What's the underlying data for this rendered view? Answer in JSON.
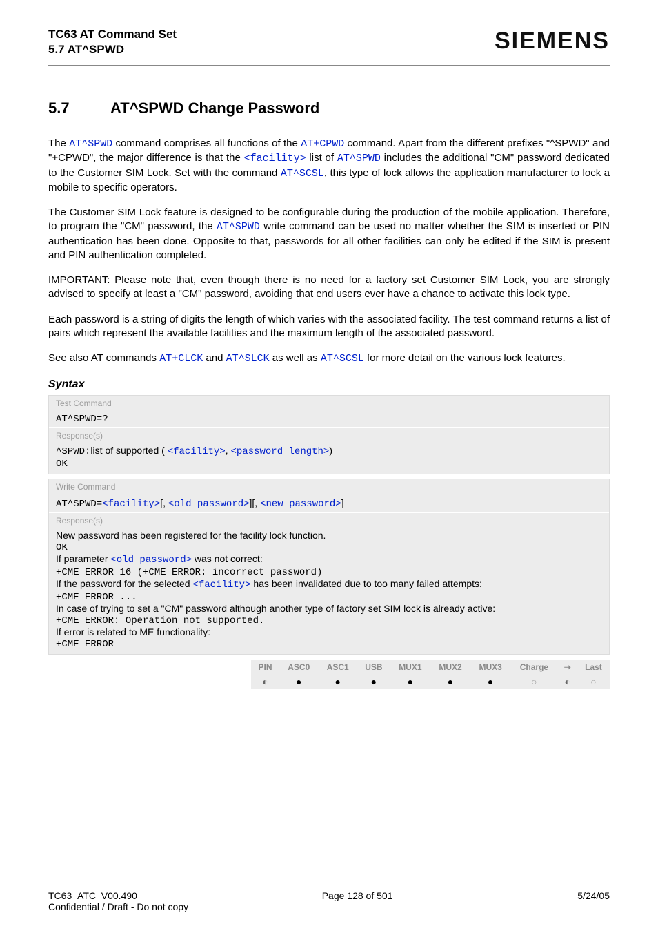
{
  "header": {
    "title": "TC63 AT Command Set",
    "subtitle": "5.7 AT^SPWD",
    "brand": "SIEMENS"
  },
  "section": {
    "number": "5.7",
    "title": "AT^SPWD   Change Password"
  },
  "para1": {
    "t1": "The ",
    "l1": "AT^SPWD",
    "t2": " command comprises all functions of the ",
    "l2": "AT+CPWD",
    "t3": " command. Apart from the different prefixes \"^SPWD\" and \"+CPWD\", the major difference is that the ",
    "l3": "<facility>",
    "t4": " list of ",
    "l4": "AT^SPWD",
    "t5": " includes the additional \"CM\" password dedicated to the Customer SIM Lock. Set with the command ",
    "l5": "AT^SCSL",
    "t6": ", this type of lock allows the application manufacturer to lock a mobile to specific operators."
  },
  "para2": {
    "t1": "The Customer SIM Lock feature is designed to be configurable during the production of the mobile application. Therefore, to program the \"CM\" password, the ",
    "l1": "AT^SPWD",
    "t2": " write command can be used no matter whether the SIM is inserted or PIN authentication has been done. Opposite to that, passwords for all other facilities can only be edited if the SIM is present and PIN authentication completed."
  },
  "para3": "IMPORTANT: Please note that, even though there is no need for a factory set Customer SIM Lock, you are strongly advised to specify at least a \"CM\" password, avoiding that end users ever have a chance to activate this lock type.",
  "para4": "Each password is a string of digits the length of which varies with the associated facility. The test command returns a list of pairs which represent the available facilities and the maximum length of the associated password.",
  "para5": {
    "t1": "See also AT commands ",
    "l1": "AT+CLCK",
    "t2": " and ",
    "l2": "AT^SLCK",
    "t3": " as well as ",
    "l3": "AT^SCSL",
    "t4": " for more detail on the various lock features."
  },
  "syntax": {
    "label": "Syntax",
    "test": {
      "label": "Test Command",
      "cmd": "AT^SPWD=?",
      "resp_label": "Response(s)",
      "resp_prefix": "^SPWD:",
      "resp_text1": "list of supported ( ",
      "resp_link1": "<facility>",
      "resp_text2": ", ",
      "resp_link2": "<password length>",
      "resp_text3": ")",
      "ok": "OK"
    },
    "write": {
      "label": "Write Command",
      "cmd_prefix": "AT^SPWD=",
      "cmd_l1": "<facility>",
      "cmd_t1": "[, ",
      "cmd_l2": "<old password>",
      "cmd_t2": "][, ",
      "cmd_l3": "<new password>",
      "cmd_t3": "]",
      "resp_label": "Response(s)",
      "r1": "New password has been registered for the facility lock function.",
      "ok": "OK",
      "r2a": "If parameter ",
      "r2l": "<old password>",
      "r2b": " was not correct:",
      "r3": "+CME ERROR 16 (+CME ERROR: incorrect password)",
      "r4a": "If the password for the selected ",
      "r4l": "<facility>",
      "r4b": " has been invalidated due to too many failed attempts:",
      "r5": "+CME ERROR ...",
      "r6": "In case of trying to set a \"CM\" password although another type of factory set SIM lock is already active:",
      "r7": "+CME ERROR: Operation not supported.",
      "r8": "If error is related to ME functionality:",
      "r9": "+CME ERROR"
    }
  },
  "attrs": {
    "headers": [
      "PIN",
      "ASC0",
      "ASC1",
      "USB",
      "MUX1",
      "MUX2",
      "MUX3",
      "Charge",
      "➝",
      "Last"
    ],
    "values": [
      "half",
      "full",
      "full",
      "full",
      "full",
      "full",
      "full",
      "empty",
      "half",
      "empty"
    ]
  },
  "footer": {
    "left1": "TC63_ATC_V00.490",
    "left2": "Confidential / Draft - Do not copy",
    "center": "Page 128 of 501",
    "right": "5/24/05"
  }
}
